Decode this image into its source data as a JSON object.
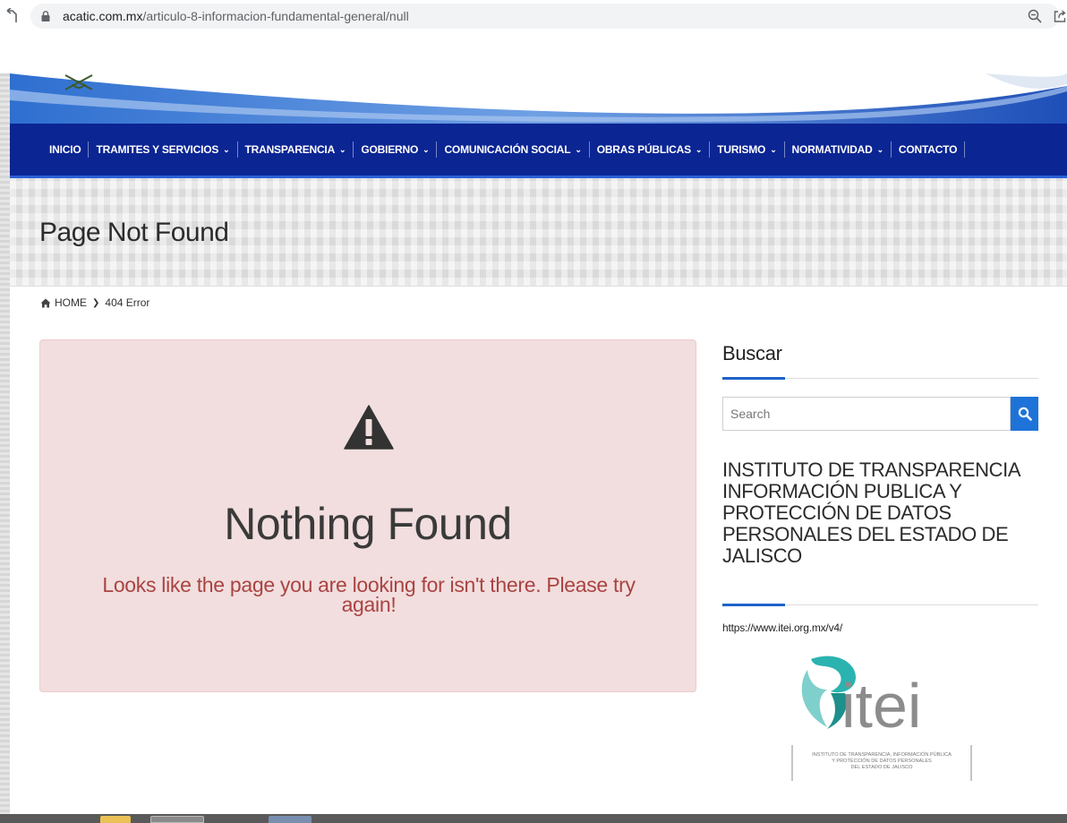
{
  "browser": {
    "url_host": "acatic.com.mx",
    "url_path": "/articulo-8-informacion-fundamental-general/null"
  },
  "nav": {
    "items": [
      {
        "label": "INICIO",
        "has_caret": false
      },
      {
        "label": "TRAMITES Y SERVICIOS",
        "has_caret": true
      },
      {
        "label": "TRANSPARENCIA",
        "has_caret": true
      },
      {
        "label": "GOBIERNO",
        "has_caret": true
      },
      {
        "label": "COMUNICACIÓN SOCIAL",
        "has_caret": true
      },
      {
        "label": "OBRAS PÚBLICAS",
        "has_caret": true
      },
      {
        "label": "TURISMO",
        "has_caret": true
      },
      {
        "label": "NORMATIVIDAD",
        "has_caret": true
      },
      {
        "label": "CONTACTO",
        "has_caret": false
      }
    ]
  },
  "page": {
    "title": "Page Not Found",
    "breadcrumb": {
      "home": "HOME",
      "current": "404 Error"
    }
  },
  "alert": {
    "heading": "Nothing Found",
    "message": "Looks like the page you are looking for isn't there. Please try again!"
  },
  "sidebar": {
    "search_title": "Buscar",
    "search_placeholder": "Search",
    "itei_heading": "INSTITUTO DE TRANSPARENCIA INFORMACIÓN PUBLICA Y PROTECCIÓN DE DATOS PERSONALES DEL ESTADO DE JALISCO",
    "itei_link": "https://www.itei.org.mx/v4/",
    "logo": {
      "wordmark": "itei",
      "caption_lines": [
        "INSTITUTO DE TRANSPARENCIA, INFORMACIÓN PÚBLICA",
        "Y PROTECCIÓN DE DATOS PERSONALES",
        "DEL ESTADO DE JALISCO"
      ]
    }
  },
  "colors": {
    "nav_bg": "#0b2593",
    "accent_blue": "#1e73d8",
    "alert_bg": "#f2dede",
    "alert_text": "#a94442",
    "logo_teal": "#2bb3b0",
    "logo_gray": "#8c8c8c"
  }
}
